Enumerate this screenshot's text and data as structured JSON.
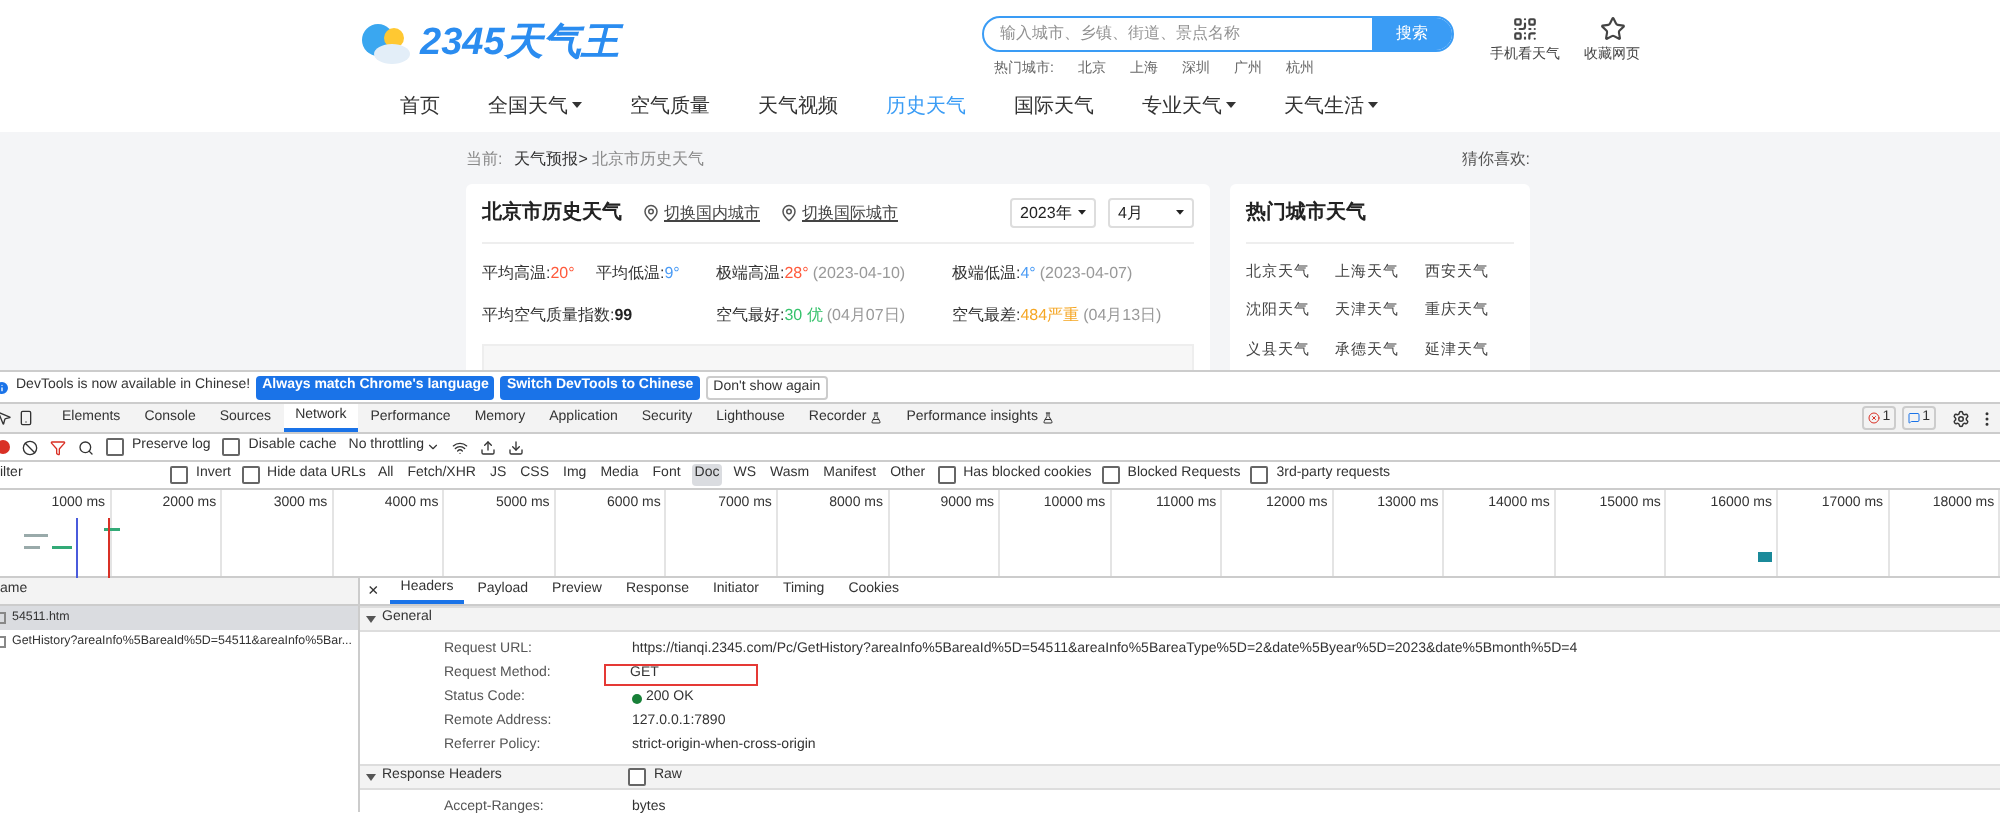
{
  "site": {
    "logo": "2345天气王",
    "search": {
      "placeholder": "输入城市、乡镇、街道、景点名称",
      "button": "搜索"
    },
    "hot_search": {
      "label": "热门城市:",
      "cities": [
        "北京",
        "上海",
        "深圳",
        "广州",
        "杭州"
      ]
    },
    "header_links": [
      {
        "kind": "qr",
        "label": "手机看天气"
      },
      {
        "kind": "star",
        "label": "收藏网页"
      }
    ],
    "nav": [
      {
        "label": "首页",
        "selected": false,
        "dropdown": false
      },
      {
        "label": "全国天气",
        "selected": false,
        "dropdown": true
      },
      {
        "label": "空气质量",
        "selected": false,
        "dropdown": false
      },
      {
        "label": "天气视频",
        "selected": false,
        "dropdown": false
      },
      {
        "label": "历史天气",
        "selected": true,
        "dropdown": false
      },
      {
        "label": "国际天气",
        "selected": false,
        "dropdown": false
      },
      {
        "label": "专业天气",
        "selected": false,
        "dropdown": true
      },
      {
        "label": "天气生活",
        "selected": false,
        "dropdown": true
      }
    ],
    "breadcrumb": {
      "prefix": "当前:",
      "link": "天气预报>",
      "current": "北京市历史天气",
      "aside": "猜你喜欢:"
    },
    "history": {
      "title": "北京市历史天气",
      "switch_links": [
        "切换国内城市",
        "切换国际城市"
      ],
      "year": "2023年",
      "month": "4月",
      "stats": [
        [
          {
            "label": "平均高温:",
            "value": "20°",
            "color": "#ff5a3c"
          },
          {
            "label": "平均低温:",
            "value": "9°",
            "color": "#4a9bf5"
          },
          {
            "label": "极端高温:",
            "value": "28°",
            "color": "#ff5a3c",
            "note": "(2023-04-10)"
          },
          {
            "label": "极端低温:",
            "value": "4°",
            "color": "#4a9bf5",
            "note": "(2023-04-07)"
          }
        ],
        [
          {
            "label": "平均空气质量指数:",
            "value": "99",
            "color": "#222222"
          },
          {
            "label": "空气最好:",
            "value": "30 优",
            "color": "#35c26b",
            "note": "(04月07日)"
          },
          {
            "label": "空气最差:",
            "value": "484严重",
            "color": "#f5a623",
            "note": "(04月13日)"
          }
        ]
      ]
    },
    "hot_cities": {
      "title": "热门城市天气",
      "cities": [
        "北京天气",
        "上海天气",
        "西安天气",
        "沈阳天气",
        "天津天气",
        "重庆天气",
        "义县天气",
        "承德天气",
        "延津天气"
      ]
    }
  },
  "devtools": {
    "infobar": {
      "message": "DevTools is now available in Chinese!",
      "buttons": [
        "Always match Chrome's language",
        "Switch DevTools to Chinese"
      ],
      "dismiss": "Don't show again"
    },
    "tabs": [
      {
        "label": "Elements",
        "selected": false,
        "flask": false
      },
      {
        "label": "Console",
        "selected": false,
        "flask": false
      },
      {
        "label": "Sources",
        "selected": false,
        "flask": false
      },
      {
        "label": "Network",
        "selected": true,
        "flask": false
      },
      {
        "label": "Performance",
        "selected": false,
        "flask": false
      },
      {
        "label": "Memory",
        "selected": false,
        "flask": false
      },
      {
        "label": "Application",
        "selected": false,
        "flask": false
      },
      {
        "label": "Security",
        "selected": false,
        "flask": false
      },
      {
        "label": "Lighthouse",
        "selected": false,
        "flask": false
      },
      {
        "label": "Recorder",
        "selected": false,
        "flask": true
      },
      {
        "label": "Performance insights",
        "selected": false,
        "flask": true
      }
    ],
    "errors": "1",
    "messages": "1",
    "toolbar": {
      "preserve_log": {
        "label": "Preserve log",
        "checked": false
      },
      "disable_cache": {
        "label": "Disable cache",
        "checked": false
      },
      "throttling": "No throttling"
    },
    "filter": {
      "placeholder": "ilter",
      "invert": {
        "label": "Invert",
        "checked": false
      },
      "hide_data_urls": {
        "label": "Hide data URLs",
        "checked": false
      },
      "types": [
        {
          "label": "All",
          "selected": false
        },
        {
          "label": "Fetch/XHR",
          "selected": false
        },
        {
          "label": "JS",
          "selected": false
        },
        {
          "label": "CSS",
          "selected": false
        },
        {
          "label": "Img",
          "selected": false
        },
        {
          "label": "Media",
          "selected": false
        },
        {
          "label": "Font",
          "selected": false
        },
        {
          "label": "Doc",
          "selected": true
        },
        {
          "label": "WS",
          "selected": false
        },
        {
          "label": "Wasm",
          "selected": false
        },
        {
          "label": "Manifest",
          "selected": false
        },
        {
          "label": "Other",
          "selected": false
        }
      ],
      "options": [
        {
          "label": "Has blocked cookies",
          "checked": false
        },
        {
          "label": "Blocked Requests",
          "checked": false
        },
        {
          "label": "3rd-party requests",
          "checked": false
        }
      ]
    },
    "timeline_ticks": [
      "1000 ms",
      "2000 ms",
      "3000 ms",
      "4000 ms",
      "5000 ms",
      "6000 ms",
      "7000 ms",
      "8000 ms",
      "9000 ms",
      "10000 ms",
      "11000 ms",
      "12000 ms",
      "13000 ms",
      "14000 ms",
      "15000 ms",
      "16000 ms",
      "17000 ms",
      "18000 ms"
    ],
    "requests": {
      "header": "ame",
      "rows": [
        {
          "name": "54511.htm",
          "selected": true
        },
        {
          "name": "GetHistory?areaInfo%5BareaId%5D=54511&areaInfo%5Bar...",
          "selected": false
        }
      ]
    },
    "detail": {
      "tabs": [
        {
          "label": "Headers",
          "selected": true
        },
        {
          "label": "Payload",
          "selected": false
        },
        {
          "label": "Preview",
          "selected": false
        },
        {
          "label": "Response",
          "selected": false
        },
        {
          "label": "Initiator",
          "selected": false
        },
        {
          "label": "Timing",
          "selected": false
        },
        {
          "label": "Cookies",
          "selected": false
        }
      ],
      "close": "×",
      "sections": [
        {
          "title": "General",
          "expanded": true,
          "rows": [
            {
              "name": "Request URL:",
              "value": "https://tianqi.2345.com/Pc/GetHistory?areaInfo%5BareaId%5D=54511&areaInfo%5BareaType%5D=2&date%5Byear%5D=2023&date%5Bmonth%5D=4",
              "highlighted": false,
              "status": false
            },
            {
              "name": "Request Method:",
              "value": "GET",
              "highlighted": true,
              "status": false
            },
            {
              "name": "Status Code:",
              "value": "200 OK",
              "highlighted": false,
              "status": true
            },
            {
              "name": "Remote Address:",
              "value": "127.0.0.1:7890",
              "highlighted": false,
              "status": false
            },
            {
              "name": "Referrer Policy:",
              "value": "strict-origin-when-cross-origin",
              "highlighted": false,
              "status": false
            }
          ]
        },
        {
          "title": "Response Headers",
          "expanded": true,
          "raw": {
            "label": "Raw",
            "checked": false
          },
          "rows": [
            {
              "name": "Accept-Ranges:",
              "value": "bytes",
              "highlighted": false,
              "status": false
            }
          ]
        }
      ]
    }
  }
}
